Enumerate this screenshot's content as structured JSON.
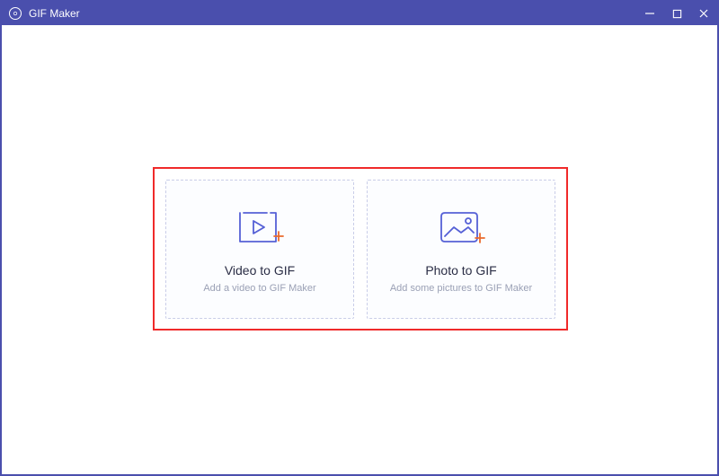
{
  "titlebar": {
    "title": "GIF Maker"
  },
  "cards": {
    "video": {
      "title": "Video to GIF",
      "subtitle": "Add a video to GIF Maker"
    },
    "photo": {
      "title": "Photo to GIF",
      "subtitle": "Add some pictures to GIF Maker"
    }
  }
}
